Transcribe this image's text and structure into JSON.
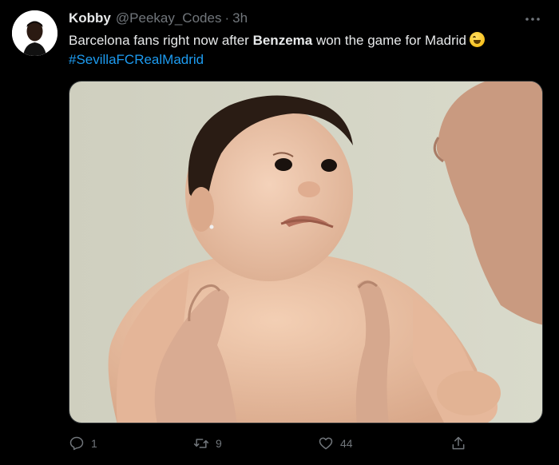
{
  "tweet": {
    "author": {
      "name": "Kobby",
      "handle": "@Peekay_Codes",
      "separator": "·",
      "time": "3h"
    },
    "text": {
      "part1": "Barcelona fans right now after ",
      "bold": "Benzema",
      "part2": " won the game for Madrid",
      "emoji": "laughing-emoji"
    },
    "hashtag": "#SevillaFCRealMadrid",
    "media": {
      "description": "baby-pouting-photo"
    },
    "actions": {
      "reply_count": "1",
      "retweet_count": "9",
      "like_count": "44"
    }
  },
  "colors": {
    "background": "#000000",
    "text": "#e7e9ea",
    "secondary": "#71767b",
    "link": "#1d9bf0"
  }
}
